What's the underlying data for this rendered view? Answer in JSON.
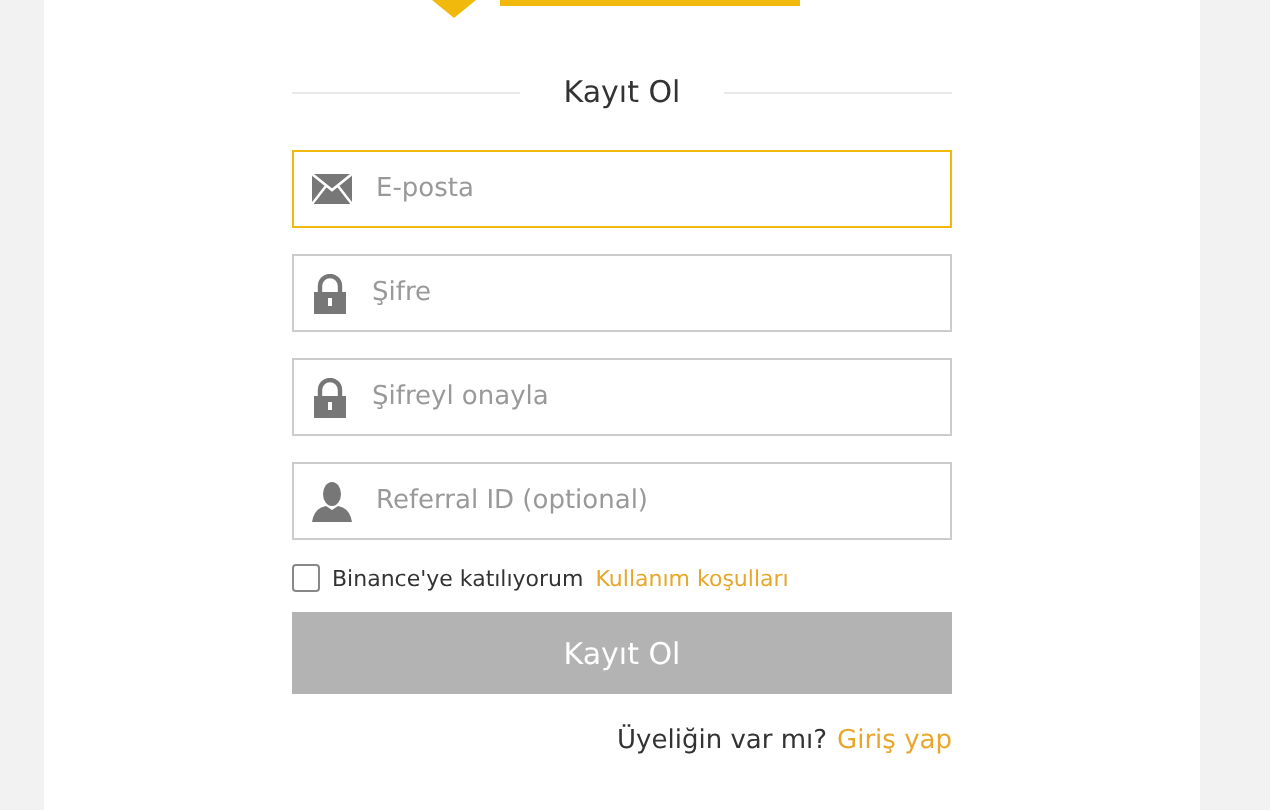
{
  "title": "Kayıt Ol",
  "fields": [
    {
      "kind": "email",
      "placeholder": "E-posta",
      "focused": true
    },
    {
      "kind": "lock",
      "placeholder": "Şifre",
      "focused": false
    },
    {
      "kind": "lock",
      "placeholder": "Şifreyl onayla",
      "focused": false
    },
    {
      "kind": "person",
      "placeholder": "Referral ID (optional)",
      "focused": false
    }
  ],
  "terms": {
    "checked": false,
    "text": "Binance'ye katılıyorum",
    "link": "Kullanım koşulları"
  },
  "submit": {
    "label": "Kayıt Ol",
    "disabled": true
  },
  "footer": {
    "text": "Üyeliğin var mı?",
    "link": "Giriş yap"
  }
}
